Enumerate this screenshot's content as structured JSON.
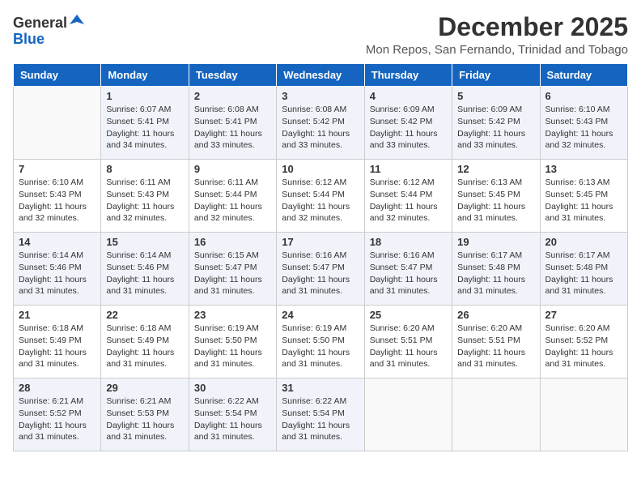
{
  "logo": {
    "general": "General",
    "blue": "Blue"
  },
  "title": "December 2025",
  "location": "Mon Repos, San Fernando, Trinidad and Tobago",
  "weekdays": [
    "Sunday",
    "Monday",
    "Tuesday",
    "Wednesday",
    "Thursday",
    "Friday",
    "Saturday"
  ],
  "weeks": [
    [
      {
        "day": "",
        "info": ""
      },
      {
        "day": "1",
        "info": "Sunrise: 6:07 AM\nSunset: 5:41 PM\nDaylight: 11 hours\nand 34 minutes."
      },
      {
        "day": "2",
        "info": "Sunrise: 6:08 AM\nSunset: 5:41 PM\nDaylight: 11 hours\nand 33 minutes."
      },
      {
        "day": "3",
        "info": "Sunrise: 6:08 AM\nSunset: 5:42 PM\nDaylight: 11 hours\nand 33 minutes."
      },
      {
        "day": "4",
        "info": "Sunrise: 6:09 AM\nSunset: 5:42 PM\nDaylight: 11 hours\nand 33 minutes."
      },
      {
        "day": "5",
        "info": "Sunrise: 6:09 AM\nSunset: 5:42 PM\nDaylight: 11 hours\nand 33 minutes."
      },
      {
        "day": "6",
        "info": "Sunrise: 6:10 AM\nSunset: 5:43 PM\nDaylight: 11 hours\nand 32 minutes."
      }
    ],
    [
      {
        "day": "7",
        "info": "Sunrise: 6:10 AM\nSunset: 5:43 PM\nDaylight: 11 hours\nand 32 minutes."
      },
      {
        "day": "8",
        "info": "Sunrise: 6:11 AM\nSunset: 5:43 PM\nDaylight: 11 hours\nand 32 minutes."
      },
      {
        "day": "9",
        "info": "Sunrise: 6:11 AM\nSunset: 5:44 PM\nDaylight: 11 hours\nand 32 minutes."
      },
      {
        "day": "10",
        "info": "Sunrise: 6:12 AM\nSunset: 5:44 PM\nDaylight: 11 hours\nand 32 minutes."
      },
      {
        "day": "11",
        "info": "Sunrise: 6:12 AM\nSunset: 5:44 PM\nDaylight: 11 hours\nand 32 minutes."
      },
      {
        "day": "12",
        "info": "Sunrise: 6:13 AM\nSunset: 5:45 PM\nDaylight: 11 hours\nand 31 minutes."
      },
      {
        "day": "13",
        "info": "Sunrise: 6:13 AM\nSunset: 5:45 PM\nDaylight: 11 hours\nand 31 minutes."
      }
    ],
    [
      {
        "day": "14",
        "info": "Sunrise: 6:14 AM\nSunset: 5:46 PM\nDaylight: 11 hours\nand 31 minutes."
      },
      {
        "day": "15",
        "info": "Sunrise: 6:14 AM\nSunset: 5:46 PM\nDaylight: 11 hours\nand 31 minutes."
      },
      {
        "day": "16",
        "info": "Sunrise: 6:15 AM\nSunset: 5:47 PM\nDaylight: 11 hours\nand 31 minutes."
      },
      {
        "day": "17",
        "info": "Sunrise: 6:16 AM\nSunset: 5:47 PM\nDaylight: 11 hours\nand 31 minutes."
      },
      {
        "day": "18",
        "info": "Sunrise: 6:16 AM\nSunset: 5:47 PM\nDaylight: 11 hours\nand 31 minutes."
      },
      {
        "day": "19",
        "info": "Sunrise: 6:17 AM\nSunset: 5:48 PM\nDaylight: 11 hours\nand 31 minutes."
      },
      {
        "day": "20",
        "info": "Sunrise: 6:17 AM\nSunset: 5:48 PM\nDaylight: 11 hours\nand 31 minutes."
      }
    ],
    [
      {
        "day": "21",
        "info": "Sunrise: 6:18 AM\nSunset: 5:49 PM\nDaylight: 11 hours\nand 31 minutes."
      },
      {
        "day": "22",
        "info": "Sunrise: 6:18 AM\nSunset: 5:49 PM\nDaylight: 11 hours\nand 31 minutes."
      },
      {
        "day": "23",
        "info": "Sunrise: 6:19 AM\nSunset: 5:50 PM\nDaylight: 11 hours\nand 31 minutes."
      },
      {
        "day": "24",
        "info": "Sunrise: 6:19 AM\nSunset: 5:50 PM\nDaylight: 11 hours\nand 31 minutes."
      },
      {
        "day": "25",
        "info": "Sunrise: 6:20 AM\nSunset: 5:51 PM\nDaylight: 11 hours\nand 31 minutes."
      },
      {
        "day": "26",
        "info": "Sunrise: 6:20 AM\nSunset: 5:51 PM\nDaylight: 11 hours\nand 31 minutes."
      },
      {
        "day": "27",
        "info": "Sunrise: 6:20 AM\nSunset: 5:52 PM\nDaylight: 11 hours\nand 31 minutes."
      }
    ],
    [
      {
        "day": "28",
        "info": "Sunrise: 6:21 AM\nSunset: 5:52 PM\nDaylight: 11 hours\nand 31 minutes."
      },
      {
        "day": "29",
        "info": "Sunrise: 6:21 AM\nSunset: 5:53 PM\nDaylight: 11 hours\nand 31 minutes."
      },
      {
        "day": "30",
        "info": "Sunrise: 6:22 AM\nSunset: 5:54 PM\nDaylight: 11 hours\nand 31 minutes."
      },
      {
        "day": "31",
        "info": "Sunrise: 6:22 AM\nSunset: 5:54 PM\nDaylight: 11 hours\nand 31 minutes."
      },
      {
        "day": "",
        "info": ""
      },
      {
        "day": "",
        "info": ""
      },
      {
        "day": "",
        "info": ""
      }
    ]
  ]
}
